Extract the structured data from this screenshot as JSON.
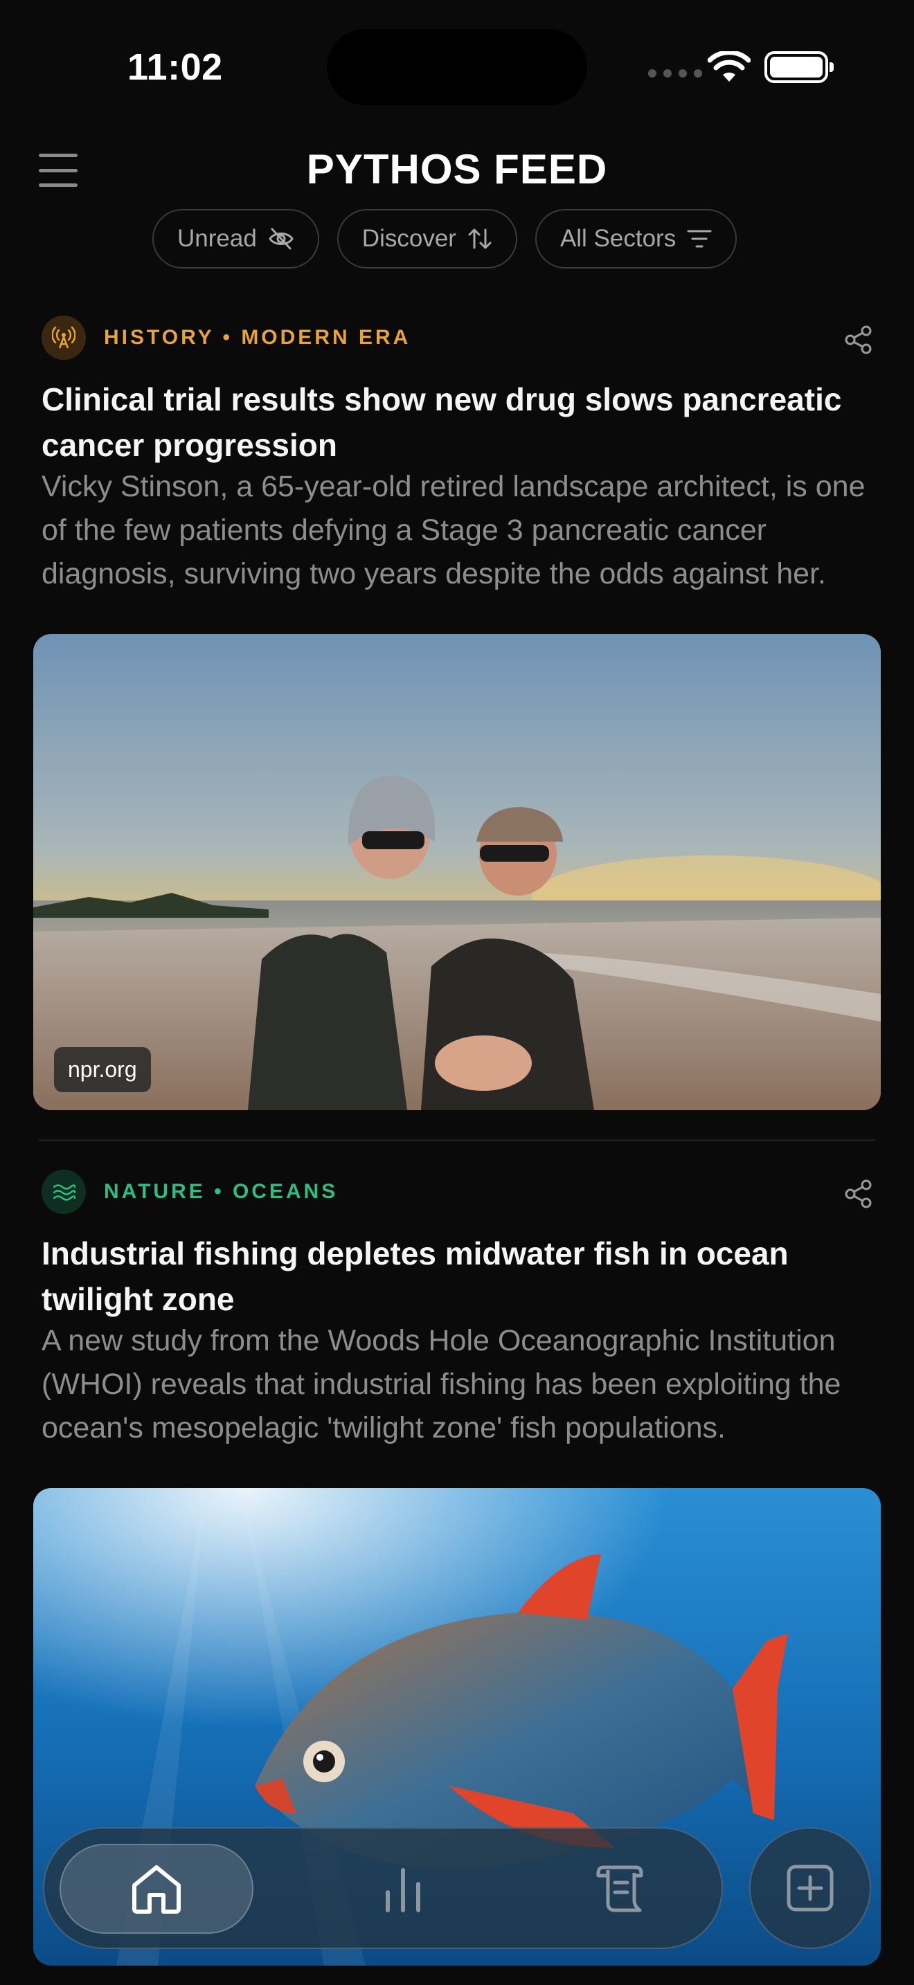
{
  "status_bar": {
    "time": "11:02"
  },
  "header": {
    "title": "PYTHOS FEED"
  },
  "filters": [
    {
      "label": "Unread",
      "icon": "eye-off-icon"
    },
    {
      "label": "Discover",
      "icon": "sort-arrows-icon"
    },
    {
      "label": "All Sectors",
      "icon": "filter-lines-icon"
    }
  ],
  "articles": [
    {
      "category": "HISTORY • MODERN ERA",
      "category_icon": "broadcast-tower-icon",
      "accent_color": "#e8a33a",
      "headline": "Clinical trial results show new drug slows pancreatic cancer progression",
      "summary": "Vicky Stinson, a 65-year-old retired landscape architect, is one of the few patients defying a Stage 3 pancreatic cancer diagnosis, surviving two years despite the odds against her.",
      "source": "npr.org"
    },
    {
      "category": "NATURE • OCEANS",
      "category_icon": "waves-icon",
      "accent_color": "#2bbf83",
      "headline": "Industrial fishing depletes midwater fish in ocean twilight zone",
      "summary": "A new study from the Woods Hole Oceanographic Institution (WHOI) reveals that industrial fishing has been exploiting the ocean's mesopelagic 'twilight zone' fish populations.",
      "source": ""
    }
  ],
  "tab_bar": {
    "items": [
      {
        "name": "home",
        "icon": "home-icon",
        "active": true
      },
      {
        "name": "stats",
        "icon": "bar-chart-icon",
        "active": false
      },
      {
        "name": "library",
        "icon": "scroll-icon",
        "active": false
      }
    ],
    "action_icon": "plus-square-icon"
  }
}
